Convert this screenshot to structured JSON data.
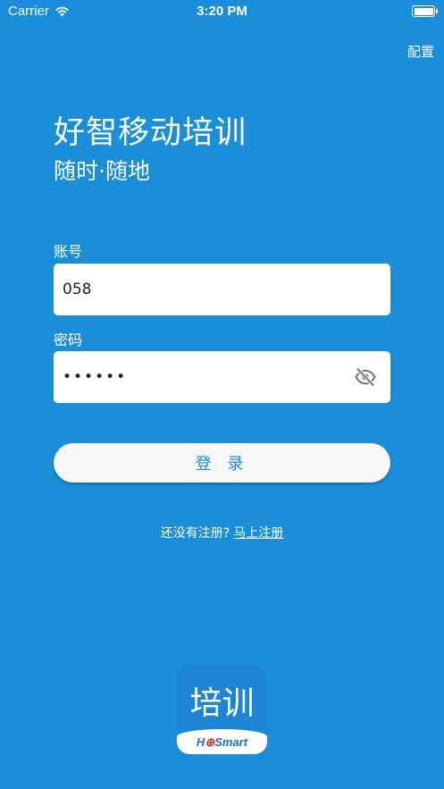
{
  "status_bar": {
    "carrier": "Carrier",
    "time": "3:20 PM"
  },
  "header": {
    "config_label": "配置"
  },
  "app": {
    "title": "好智移动培训",
    "subtitle": "随时·随地"
  },
  "form": {
    "account_label": "账号",
    "account_value": "058",
    "password_label": "密码",
    "password_masked": "••••••",
    "login_label": "登 录"
  },
  "register": {
    "prompt": "还没有注册?",
    "link": "马上注册"
  },
  "logo": {
    "text": "培训",
    "brand_prefix": "H",
    "brand_mark": "⊕",
    "brand_suffix": "Smart"
  },
  "icons": {
    "wifi": "wifi-icon",
    "battery": "battery-icon",
    "eye_off": "eye-off-icon"
  },
  "colors": {
    "background": "#1a8ed8",
    "button_text": "#1a8ed8",
    "logo_red": "#d9332b"
  }
}
